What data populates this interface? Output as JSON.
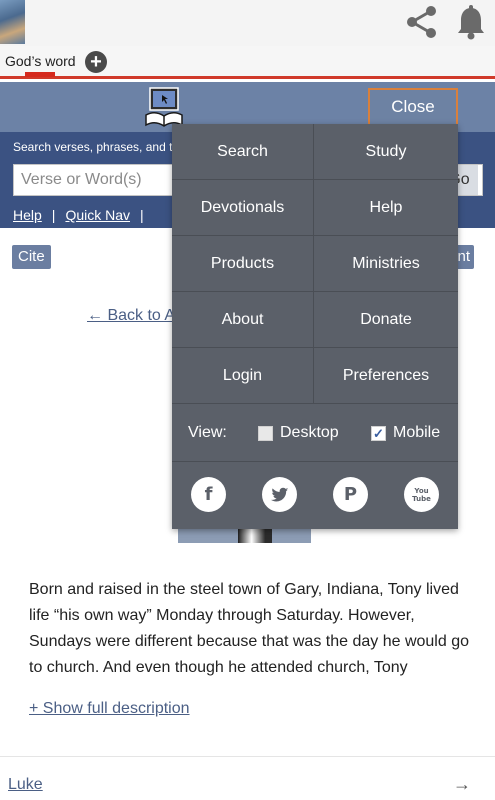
{
  "appbar": {
    "share_icon": "share-icon",
    "bell_icon": "bell-icon"
  },
  "tabs": {
    "active_label": "God’s word",
    "add_icon": "+"
  },
  "header": {
    "close_label": "Close"
  },
  "search": {
    "label": "Search verses, phrases, and t",
    "placeholder": "Verse or Word(s)",
    "go_label": "Go",
    "links": [
      "Help",
      "Quick Nav"
    ],
    "separator": "|"
  },
  "content": {
    "cite_label": "Cite",
    "right_button_partial": "nt",
    "back_link": "← Back to A",
    "description": "Born and raised in the steel town of Gary, Indiana, Tony lived life “his own way” Monday through Saturday. However, Sundays were different because that was the day he would go to church. And even though he attended church, Tony",
    "show_more": "+ Show full description",
    "luke_link": "Luke",
    "luke_arrow": "→"
  },
  "menu": {
    "items": [
      "Search",
      "Study",
      "Devotionals",
      "Help",
      "Products",
      "Ministries",
      "About",
      "Donate",
      "Login",
      "Preferences"
    ],
    "view_label": "View:",
    "view_options": [
      {
        "label": "Desktop",
        "checked": false
      },
      {
        "label": "Mobile",
        "checked": true
      }
    ],
    "social": [
      {
        "icon": "facebook-icon",
        "glyph": "f"
      },
      {
        "icon": "twitter-icon",
        "glyph": "🐦"
      },
      {
        "icon": "pinterest-icon",
        "glyph": "P"
      },
      {
        "icon": "youtube-icon",
        "glyph": "You Tube"
      }
    ]
  },
  "colors": {
    "header": "#6c82a6",
    "search_band": "#3b5282",
    "menu": "#5b6069",
    "accent_red": "#d52a1e",
    "close_border": "#d9803c"
  }
}
